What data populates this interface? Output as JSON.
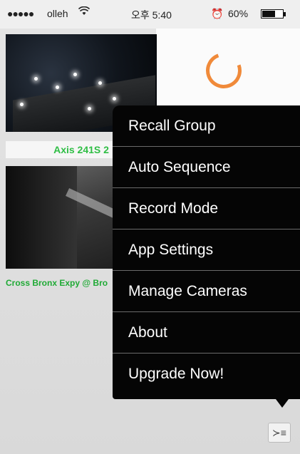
{
  "status_bar": {
    "signal": "●●●●●",
    "carrier": "olleh",
    "wifi_icon": "wifi-icon",
    "time": "오후 5:40",
    "alarm_icon": "alarm-clock-icon",
    "battery_percent": "60%",
    "battery_level": 0.6
  },
  "cameras": [
    {
      "caption": "Axis 241S 2"
    },
    {
      "caption": "Cross Bronx Expy @ Bro"
    }
  ],
  "menu": {
    "items": [
      {
        "label": "Recall Group"
      },
      {
        "label": "Auto Sequence"
      },
      {
        "label": "Record Mode"
      },
      {
        "label": "App Settings"
      },
      {
        "label": "Manage Cameras"
      },
      {
        "label": "About"
      },
      {
        "label": "Upgrade Now!"
      }
    ]
  },
  "toolbar": {
    "menu_button_icon": "menu-list-icon",
    "menu_button_glyph": "≻≡"
  },
  "colors": {
    "caption_green": "#2fbe45",
    "spinner_orange": "#f08a3a",
    "menu_background": "#050505"
  }
}
